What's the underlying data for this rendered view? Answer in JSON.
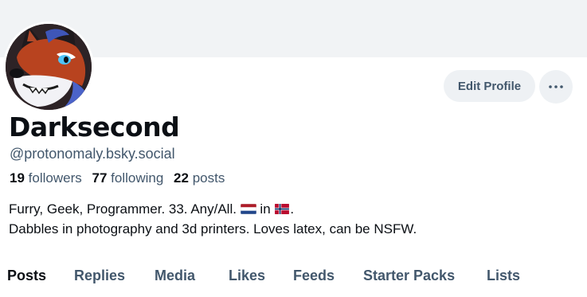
{
  "profile": {
    "display_name": "Darksecond",
    "handle": "@protonomaly.bsky.social",
    "avatar_icon": "fox-avatar",
    "stats": {
      "followers_count": "19",
      "followers_label": "followers",
      "following_count": "77",
      "following_label": "following",
      "posts_count": "22",
      "posts_label": "posts"
    },
    "bio": {
      "line1_text": "Furry, Geek, Programmer. 33. Any/All.",
      "line1_in": "in",
      "line1_end": ".",
      "flag1": "netherlands-flag",
      "flag2": "norway-flag",
      "line2": "Dabbles in photography and 3d printers. Loves latex, can be NSFW."
    }
  },
  "actions": {
    "edit_profile_label": "Edit Profile",
    "more_icon": "ellipsis-icon"
  },
  "tabs": [
    {
      "label": "Posts",
      "active": true
    },
    {
      "label": "Replies",
      "active": false
    },
    {
      "label": "Media",
      "active": false
    },
    {
      "label": "Likes",
      "active": false
    },
    {
      "label": "Feeds",
      "active": false
    },
    {
      "label": "Starter Packs",
      "active": false
    },
    {
      "label": "Lists",
      "active": false
    }
  ],
  "colors": {
    "text_primary": "#0b0f14",
    "text_secondary": "#42576c",
    "button_bg": "#eef1f4",
    "banner_bg": "#f1f3f5"
  }
}
